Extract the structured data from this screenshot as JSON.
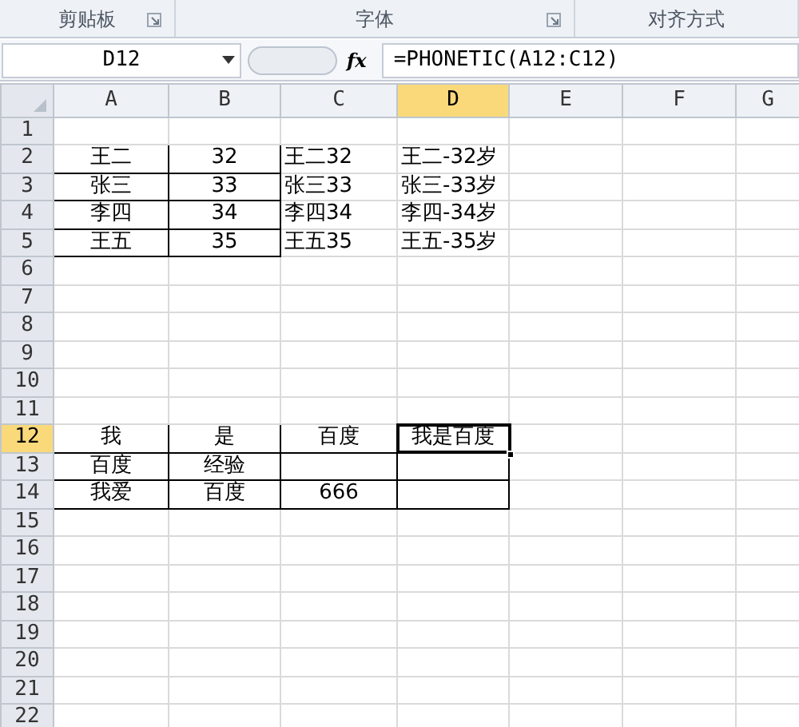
{
  "ribbon_groups": [
    {
      "label": "剪贴板",
      "launcher": true
    },
    {
      "label": "字体",
      "launcher": true
    },
    {
      "label": "对齐方式",
      "launcher": false
    }
  ],
  "name_box": "D12",
  "formula_icon": "fx",
  "formula": "=PHONETIC(A12:C12)",
  "columns": [
    {
      "label": "A",
      "selected": false
    },
    {
      "label": "B",
      "selected": false
    },
    {
      "label": "C",
      "selected": false
    },
    {
      "label": "D",
      "selected": true
    },
    {
      "label": "E",
      "selected": false
    },
    {
      "label": "F",
      "selected": false
    },
    {
      "label": "G",
      "selected": false
    }
  ],
  "rows": [
    {
      "number": "1",
      "selected": false
    },
    {
      "number": "2",
      "selected": false,
      "cells": [
        {
          "text": "王二",
          "bordered": true,
          "selected": false
        },
        {
          "text": "32",
          "bordered": true,
          "selected": false
        },
        {
          "text": "王二32",
          "bordered": false,
          "selected": false
        },
        {
          "text": "王二-32岁",
          "bordered": false,
          "selected": false
        }
      ]
    },
    {
      "number": "3",
      "selected": false,
      "cells": [
        {
          "text": "张三",
          "bordered": true,
          "selected": false
        },
        {
          "text": "33",
          "bordered": true,
          "selected": false
        },
        {
          "text": "张三33",
          "bordered": false,
          "selected": false
        },
        {
          "text": "张三-33岁",
          "bordered": false,
          "selected": false
        }
      ]
    },
    {
      "number": "4",
      "selected": false,
      "cells": [
        {
          "text": "李四",
          "bordered": true,
          "selected": false
        },
        {
          "text": "34",
          "bordered": true,
          "selected": false
        },
        {
          "text": "李四34",
          "bordered": false,
          "selected": false
        },
        {
          "text": "李四-34岁",
          "bordered": false,
          "selected": false
        }
      ]
    },
    {
      "number": "5",
      "selected": false,
      "cells": [
        {
          "text": "王五",
          "bordered": true,
          "selected": false
        },
        {
          "text": "35",
          "bordered": true,
          "selected": false
        },
        {
          "text": "王五35",
          "bordered": false,
          "selected": false
        },
        {
          "text": "王五-35岁",
          "bordered": false,
          "selected": false
        }
      ]
    },
    {
      "number": "6",
      "selected": false
    },
    {
      "number": "7",
      "selected": false
    },
    {
      "number": "8",
      "selected": false
    },
    {
      "number": "9",
      "selected": false
    },
    {
      "number": "10",
      "selected": false
    },
    {
      "number": "11",
      "selected": false
    },
    {
      "number": "12",
      "selected": true,
      "cells": [
        {
          "text": "我",
          "bordered": true,
          "selected": false
        },
        {
          "text": "是",
          "bordered": true,
          "selected": false
        },
        {
          "text": "百度",
          "bordered": true,
          "selected": false
        },
        {
          "text": "我是百度",
          "bordered": true,
          "selected": true
        }
      ]
    },
    {
      "number": "13",
      "selected": false,
      "cells": [
        {
          "text": "百度",
          "bordered": true,
          "selected": false
        },
        {
          "text": "经验",
          "bordered": true,
          "selected": false
        },
        {
          "bordered": true,
          "selected": false
        },
        {
          "bordered": true,
          "selected": false
        }
      ]
    },
    {
      "number": "14",
      "selected": false,
      "cells": [
        {
          "text": "我爱",
          "bordered": true,
          "selected": false
        },
        {
          "text": "百度",
          "bordered": true,
          "selected": false
        },
        {
          "text": "666",
          "bordered": true,
          "selected": false
        },
        {
          "bordered": true,
          "selected": false
        }
      ]
    },
    {
      "number": "15",
      "selected": false
    },
    {
      "number": "16",
      "selected": false
    },
    {
      "number": "17",
      "selected": false
    },
    {
      "number": "18",
      "selected": false
    },
    {
      "number": "19",
      "selected": false
    },
    {
      "number": "20",
      "selected": false
    },
    {
      "number": "21",
      "selected": false
    },
    {
      "number": "22",
      "selected": false
    }
  ]
}
